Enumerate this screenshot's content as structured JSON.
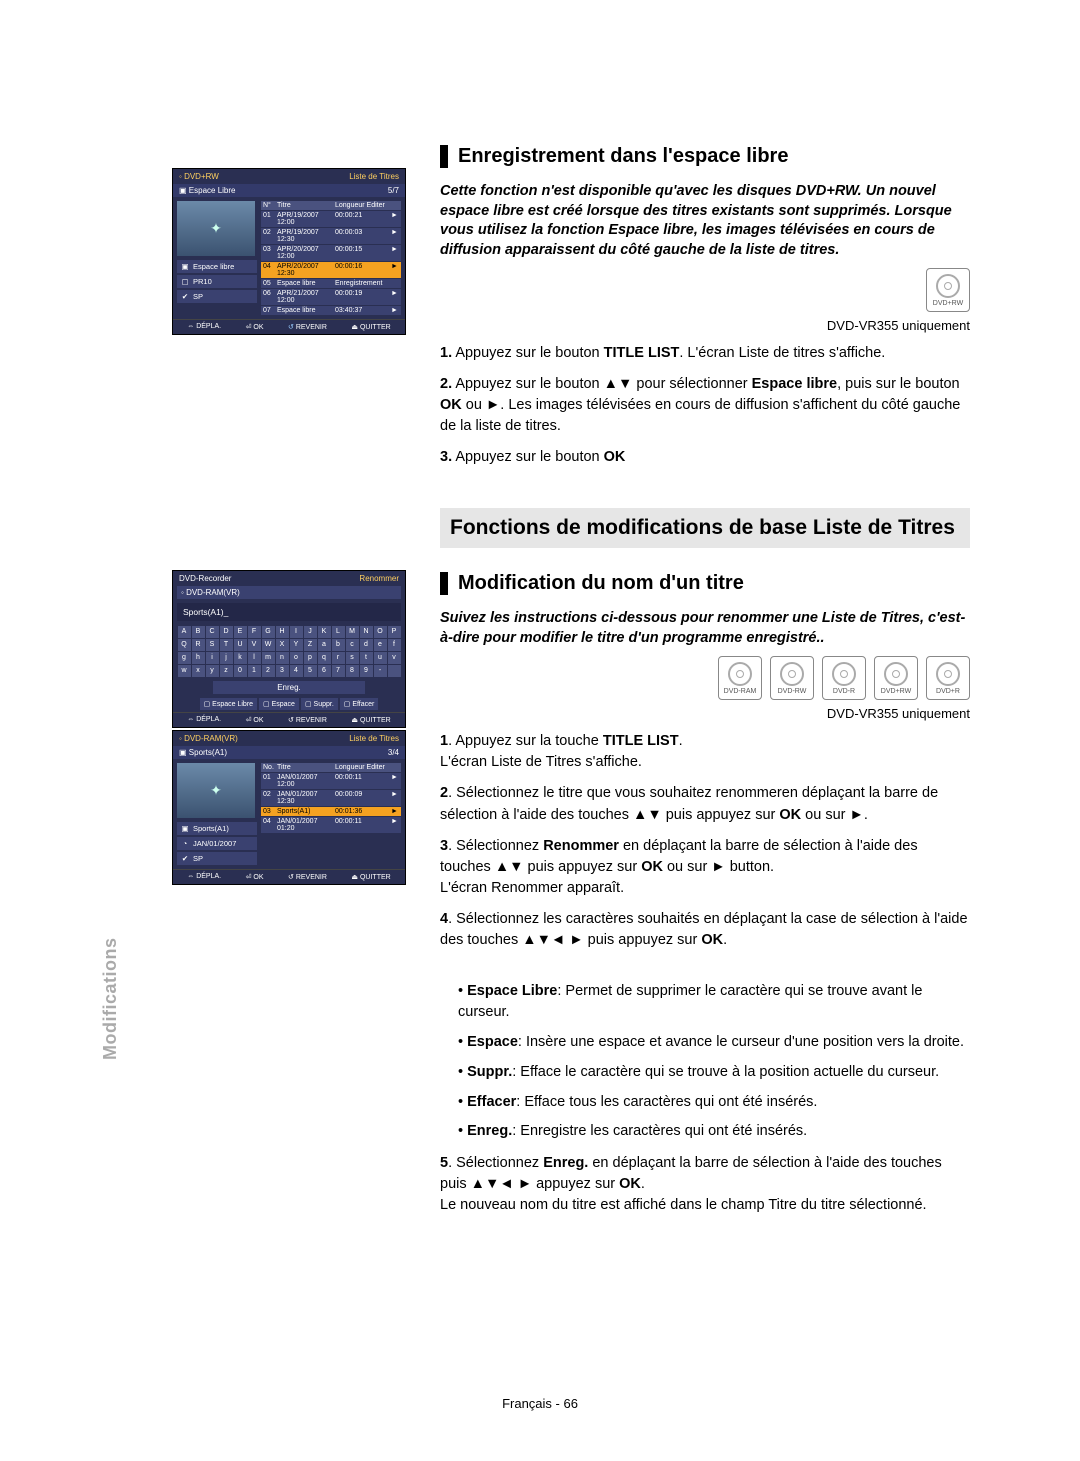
{
  "section1": {
    "heading": "Enregistrement dans l'espace libre",
    "intro": "Cette fonction n'est disponible qu'avec les disques DVD+RW. Un nouvel espace libre est créé lorsque des titres existants sont supprimés. Lorsque vous utilisez la fonction Espace libre, les images télévisées en cours de diffusion apparaissent du côté gauche de la liste de titres.",
    "disc_labels": [
      "DVD+RW"
    ],
    "note": "DVD-VR355 uniquement",
    "steps": [
      {
        "n": "1.",
        "text": "Appuyez sur le bouton ",
        "b1": "TITLE LIST",
        "text2": ". L'écran Liste de titres s'affiche."
      },
      {
        "n": "2.",
        "text": "Appuyez sur le bouton ▲▼ pour sélectionner ",
        "b1": "Espace libre",
        "text2": ", puis sur le bouton ",
        "b2": "OK",
        "text3": " ou ►. Les images télévisées en cours de diffusion s'affichent du côté gauche de la liste de titres."
      },
      {
        "n": "3.",
        "text": "Appuyez sur le bouton ",
        "b1": "OK"
      }
    ]
  },
  "funcbar": "Fonctions de modifications de base Liste de Titres",
  "section2": {
    "heading": "Modification du nom d'un titre",
    "intro": "Suivez les instructions ci-dessous pour renommer une Liste de Titres, c'est-à-dire pour modifier le titre d'un programme enregistré..",
    "disc_labels": [
      "DVD-RAM",
      "DVD-RW",
      "DVD-R",
      "DVD+RW",
      "DVD+R"
    ],
    "note": "DVD-VR355 uniquement",
    "steps": [
      {
        "n": "1",
        "text": ". Appuyez sur la touche ",
        "b1": "TITLE LIST",
        "text2": ".",
        "br": "L'écran Liste de Titres s'affiche."
      },
      {
        "n": "2",
        "text": ". Sélectionnez le titre que vous souhaitez renommeren déplaçant la barre de sélection à l'aide des touches ▲▼ puis appuyez sur ",
        "b1": "OK",
        "text2": " ou sur ►."
      },
      {
        "n": "3",
        "text": ". Sélectionnez ",
        "b1": "Renommer",
        "text2": " en déplaçant la barre de sélection à l'aide des touches ▲▼ puis appuyez sur ",
        "b2": "OK",
        "text3": " ou sur ► button.",
        "br": "L'écran Renommer apparaît."
      },
      {
        "n": "4",
        "text": ". Sélectionnez les caractères souhaités en déplaçant la case de sélection à l'aide des touches ▲▼◄ ► puis appuyez sur ",
        "b1": "OK",
        "text2": "."
      }
    ],
    "bullets": [
      {
        "b": "Espace Libre",
        "t": ": Permet de supprimer le caractère qui se trouve avant le curseur."
      },
      {
        "b": "Espace",
        "t": ": Insère une espace et avance le curseur d'une position vers la droite."
      },
      {
        "b": "Suppr.",
        "t": ": Efface le caractère qui se trouve à la position actuelle du curseur."
      },
      {
        "b": "Effacer",
        "t": ": Efface tous les caractères qui ont été insérés."
      },
      {
        "b": "Enreg.",
        "t": ": Enregistre les caractères qui ont été insérés."
      }
    ],
    "step5": {
      "n": "5",
      "text": ". Sélectionnez ",
      "b1": "Enreg.",
      "text2": " en déplaçant la barre de sélection à l'aide des touches puis ▲▼◄ ► appuyez sur ",
      "b2": "OK",
      "text3": ".",
      "br": "Le nouveau nom du titre est affiché dans le champ Titre du titre sélectionné."
    }
  },
  "footer": "Français - 66",
  "side_label": "Modifications",
  "shot1": {
    "disc": "DVD+RW",
    "headr": "Liste de Titres",
    "sub_l": "Espace Libre",
    "sub_r": "5/7",
    "cols": [
      "N°",
      "Titre",
      "Longueur Editer"
    ],
    "rows": [
      {
        "n": "01",
        "t": "APR/19/2007 12:00",
        "l": "00:00:21",
        "a": "►"
      },
      {
        "n": "02",
        "t": "APR/19/2007 12:30",
        "l": "00:00:03",
        "a": "►"
      },
      {
        "n": "03",
        "t": "APR/20/2007 12:00",
        "l": "00:00:15",
        "a": "►"
      },
      {
        "n": "04",
        "t": "APR/20/2007 12:30",
        "l": "00:00:16",
        "a": "►",
        "hl": true
      },
      {
        "n": "05",
        "t": "Espace libre",
        "l": "Enregistrement",
        "a": ""
      },
      {
        "n": "06",
        "t": "APR/21/2007 12:00",
        "l": "00:00:19",
        "a": "►"
      },
      {
        "n": "07",
        "t": "Espace libre",
        "l": "03:40:37",
        "a": "►"
      }
    ],
    "side": [
      "Espace libre",
      "PR10",
      "SP"
    ],
    "ctrl": {
      "a": "DÉPLA.",
      "b": "OK",
      "c": "REVENIR",
      "d": "QUITTER"
    }
  },
  "shot2": {
    "title_l": "DVD-Recorder",
    "title_r": "Renommer",
    "disk": "DVD-RAM(VR)",
    "name": "Sports(A1)",
    "kbd": [
      [
        "A",
        "B",
        "C",
        "D",
        "E",
        "F",
        "G",
        "H",
        "I",
        "J",
        "K",
        "L",
        "M",
        "N",
        "O",
        "P"
      ],
      [
        "Q",
        "R",
        "S",
        "T",
        "U",
        "V",
        "W",
        "X",
        "Y",
        "Z",
        "a",
        "b",
        "c",
        "d",
        "e",
        "f"
      ],
      [
        "g",
        "h",
        "i",
        "j",
        "k",
        "l",
        "m",
        "n",
        "o",
        "p",
        "q",
        "r",
        "s",
        "t",
        "u",
        "v"
      ],
      [
        "w",
        "x",
        "y",
        "z",
        "0",
        "1",
        "2",
        "3",
        "4",
        "5",
        "6",
        "7",
        "8",
        "9",
        "-",
        " "
      ]
    ],
    "enreg": "Enreg.",
    "funcs": [
      "Espace Libre",
      "Espace",
      "Suppr.",
      "Effacer"
    ],
    "ctrl": {
      "a": "DÉPLA.",
      "b": "OK",
      "c": "REVENIR",
      "d": "QUITTER"
    }
  },
  "shot3": {
    "disc": "DVD-RAM(VR)",
    "headr": "Liste de Titres",
    "sub_l": "Sports(A1)",
    "sub_r": "3/4",
    "cols": [
      "No.",
      "Titre",
      "Longueur Editer"
    ],
    "rows": [
      {
        "n": "01",
        "t": "JAN/01/2007 12:00",
        "l": "00:00:11",
        "a": "►"
      },
      {
        "n": "02",
        "t": "JAN/01/2007 12:30",
        "l": "00:00:09",
        "a": "►"
      },
      {
        "n": "03",
        "t": "Sports(A1)",
        "l": "00:01:36",
        "a": "►",
        "hl": true
      },
      {
        "n": "04",
        "t": "JAN/01/2007 01:20",
        "l": "00:00:11",
        "a": "►"
      }
    ],
    "side": [
      "Sports(A1)",
      "JAN/01/2007",
      "SP"
    ],
    "ctrl": {
      "a": "DÉPLA.",
      "b": "OK",
      "c": "REVENIR",
      "d": "QUITTER"
    }
  }
}
